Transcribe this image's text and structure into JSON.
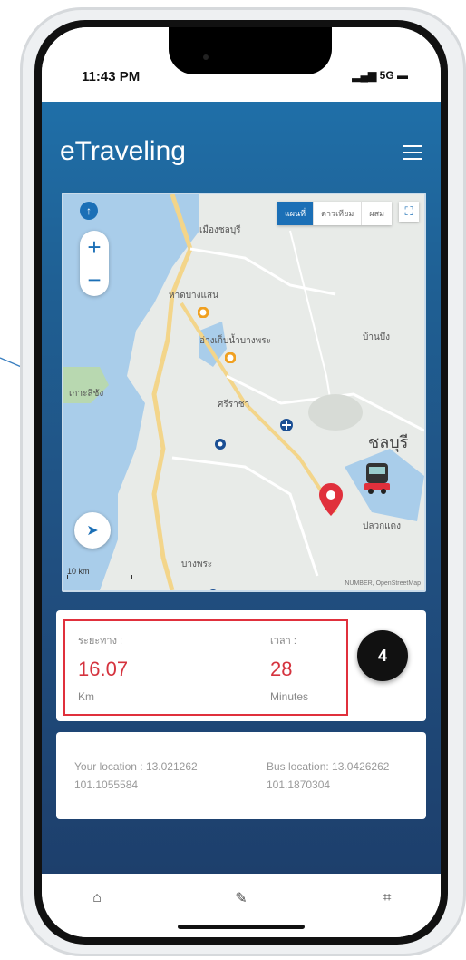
{
  "status": {
    "time": "11:43 PM",
    "signal": "5G"
  },
  "app": {
    "title": "eTraveling"
  },
  "map": {
    "tabs": [
      "แผนที่",
      "ดาวเทียม",
      "ผสม"
    ],
    "labels": {
      "muang": "เมืองชลบุรี",
      "chonburi": "ชลบุรี",
      "sriracha": "ศรีราชา",
      "bangsaen": "บางแสน",
      "bangpra": "บางพระ",
      "koh_si_chang": "เกาะสีชัง",
      "ban_bueng": "บ้านบึง",
      "pluak_daeng": "ปลวกแดง",
      "tien_mu": "หาดบางแสน",
      "beach": "อ่างเก็บน้ำบางพระ"
    },
    "scale_text": "10 km",
    "credit": "NUMBER, OpenStreetMap"
  },
  "distance": {
    "label": "ระยะทาง :",
    "value": "16.07",
    "unit": "Km"
  },
  "duration": {
    "label": "เวลา :",
    "value": "28",
    "unit": "Minutes"
  },
  "step": {
    "number": "4"
  },
  "locations": {
    "you": "Your location : 13.021262",
    "you2": "101.1055584",
    "bus": "Bus location: 13.0426262",
    "bus2": "101.1870304"
  },
  "tabbar": {
    "icons": [
      "home-icon",
      "edit-icon",
      "scan-icon"
    ]
  }
}
